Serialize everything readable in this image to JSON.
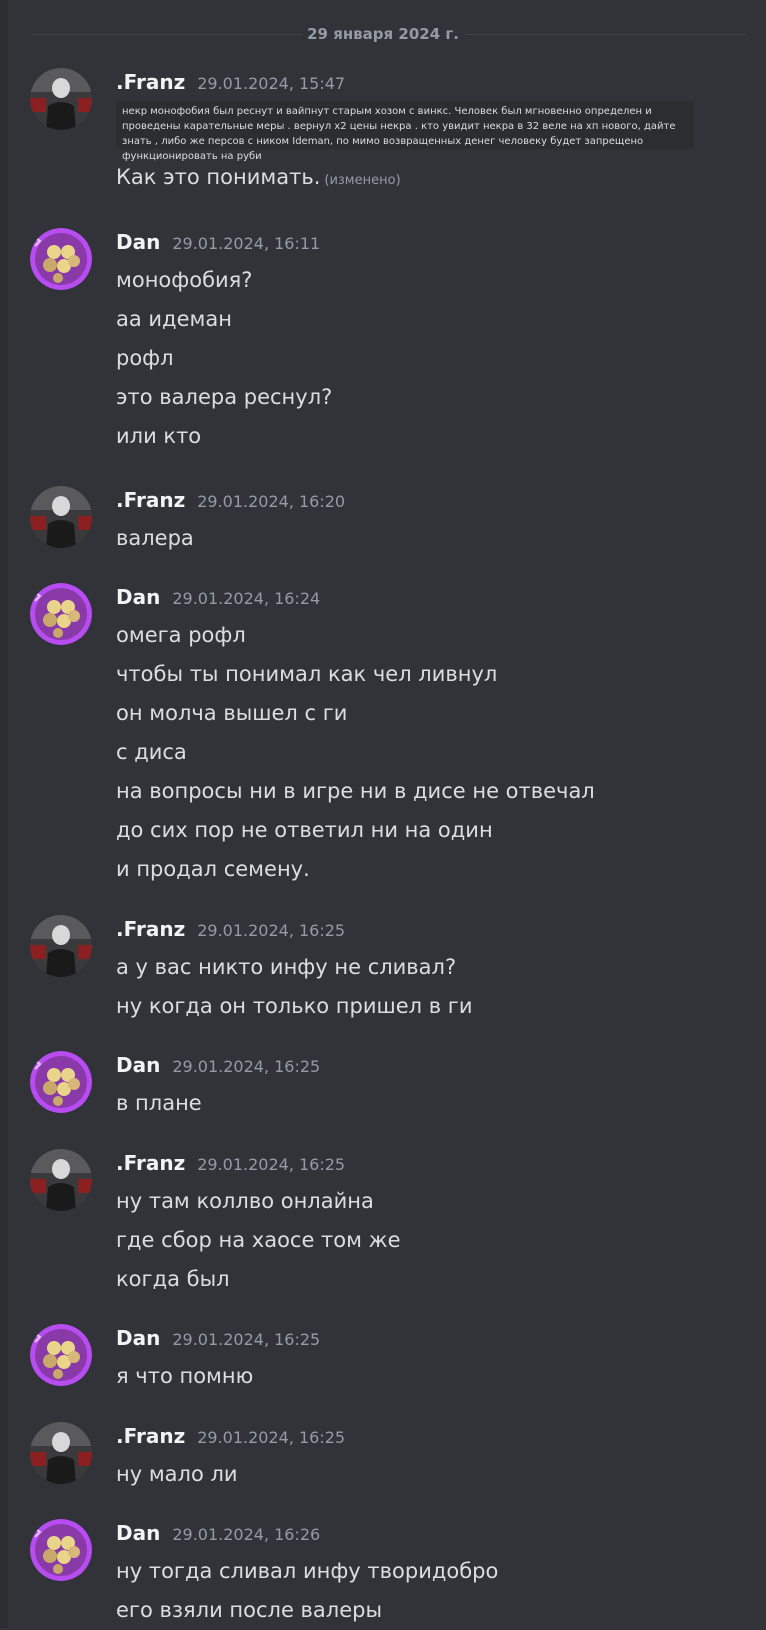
{
  "date_divider": "29 января 2024 г.",
  "colors": {
    "background": "#313338",
    "author": "#f2f3f5",
    "timestamp": "#949ba4",
    "text": "#dbdee1"
  },
  "messages": [
    {
      "author": ".Franz",
      "timestamp": "29.01.2024, 15:47",
      "quoted_text": "некр монофобия был реснут и вайпнут старым хозом с винкс. Человек был мгновенно определен и проведены карательные меры . вернул x2 цены некра . кто увидит некра в 32 веле на хп нового, дайте знать , либо же персов с ником Ideman, по мимо возвращенных денег человеку будет запрещено функционировать на руби",
      "lines": [
        "Как это понимать."
      ],
      "edited_label": "(изменено)"
    },
    {
      "author": "Dan",
      "timestamp": "29.01.2024, 16:11",
      "lines": [
        "монофобия?",
        "аа идеман",
        "рофл",
        "это валера реснул?",
        "или кто"
      ]
    },
    {
      "author": ".Franz",
      "timestamp": "29.01.2024, 16:20",
      "lines": [
        "валера"
      ]
    },
    {
      "author": "Dan",
      "timestamp": "29.01.2024, 16:24",
      "lines": [
        "омега рофл",
        "чтобы ты понимал как чел ливнул",
        "он молча вышел с ги",
        "с диса",
        "на вопросы ни в игре ни в дисе не отвечал",
        "до сих пор не ответил ни на один",
        "и продал семену."
      ]
    },
    {
      "author": ".Franz",
      "timestamp": "29.01.2024, 16:25",
      "lines": [
        "а у вас никто инфу не сливал?",
        "ну когда он только пришел в ги"
      ]
    },
    {
      "author": "Dan",
      "timestamp": "29.01.2024, 16:25",
      "lines": [
        "в плане"
      ]
    },
    {
      "author": ".Franz",
      "timestamp": "29.01.2024, 16:25",
      "lines": [
        "ну там коллво онлайна",
        "где сбор на хаосе том же",
        "когда был"
      ]
    },
    {
      "author": "Dan",
      "timestamp": "29.01.2024, 16:25",
      "lines": [
        "я что помню"
      ]
    },
    {
      "author": ".Franz",
      "timestamp": "29.01.2024, 16:25",
      "lines": [
        "ну мало ли"
      ]
    },
    {
      "author": "Dan",
      "timestamp": "29.01.2024, 16:26",
      "lines": [
        "ну тогда сливал инфу творидобро",
        "его взяли после валеры"
      ]
    }
  ]
}
